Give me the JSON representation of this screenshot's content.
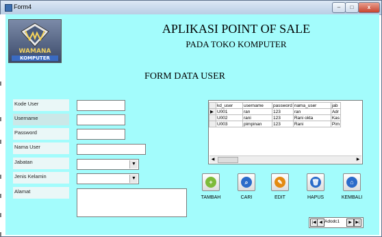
{
  "window": {
    "title": "Form4",
    "min_glyph": "–",
    "max_glyph": "□",
    "close_glyph": "x"
  },
  "logo": {
    "brand": "WAMANA",
    "sub": "KOMPUTER"
  },
  "header": {
    "title": "APLIKASI POINT OF SALE",
    "subtitle": "PADA TOKO KOMPUTER",
    "form_title": "FORM DATA USER"
  },
  "form": {
    "labels": {
      "kode_user": "Kode User",
      "username": "Username",
      "password": "Password",
      "nama_user": "Nama User",
      "jabatan": "Jabatan",
      "jenis_kelamin": "Jenis Kelamin",
      "alamat": "Alamat"
    },
    "values": {
      "kode_user": "",
      "username": "",
      "password": "",
      "nama_user": "",
      "jabatan": "",
      "jenis_kelamin": "",
      "alamat": ""
    }
  },
  "grid": {
    "columns": [
      "kd_user",
      "username",
      "password",
      "nama_user",
      "jab"
    ],
    "rows": [
      [
        "U001",
        "ran",
        "123",
        "ran",
        "Adr"
      ],
      [
        "U002",
        "rani",
        "123",
        "Rani okta",
        "Kas"
      ],
      [
        "U003",
        "pimpinan",
        "123",
        "Rani",
        "Pim"
      ]
    ]
  },
  "buttons": {
    "tambah": "TAMBAH",
    "cari": "CARI",
    "edit": "EDIT",
    "hapus": "HAPUS",
    "kembali": "KEMBALI"
  },
  "navigator": {
    "caption": "Adodc1"
  }
}
